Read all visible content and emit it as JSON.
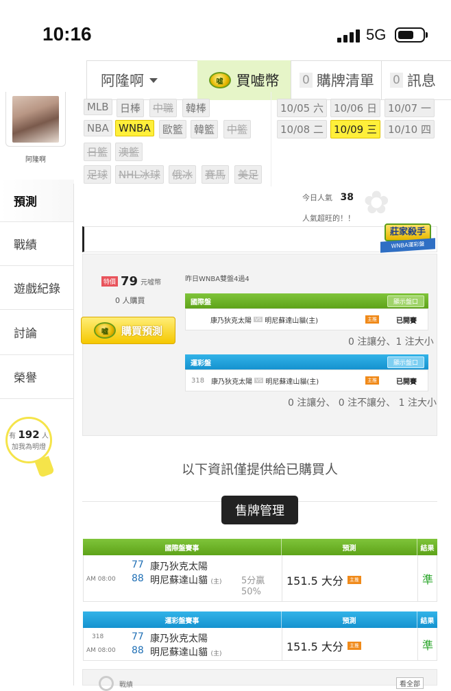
{
  "status_bar": {
    "time": "10:16",
    "network": "5G"
  },
  "top_nav": {
    "user": "阿隆啊",
    "buy_coin": "買嘘幣",
    "coin_icon_text": "嘘",
    "cart_count": "0",
    "cart_label": "購牌清單",
    "msg_count": "0",
    "msg_label": "訊息"
  },
  "profile": {
    "name": "阿隆啊"
  },
  "leagues": {
    "row1": [
      "MLB",
      "日棒",
      "中職",
      "韓棒"
    ],
    "row2": [
      "NBA",
      "WNBA",
      "歐籃",
      "韓籃",
      "中籃"
    ],
    "row3": [
      "日籃",
      "澳籃"
    ],
    "row4": [
      "足球",
      "NHL冰球",
      "俄冰",
      "賽馬",
      "美足"
    ]
  },
  "dates": {
    "row1": [
      "10/05 六",
      "10/06 日",
      "10/07 一"
    ],
    "row2": [
      "10/08 二",
      "10/09 三",
      "10/10 四"
    ]
  },
  "sidebar": {
    "items": [
      {
        "label": "預測"
      },
      {
        "label": "戰績"
      },
      {
        "label": "遊戲紀錄"
      },
      {
        "label": "討論"
      },
      {
        "label": "榮譽"
      }
    ]
  },
  "fans": {
    "prefix": "有",
    "count": "192",
    "suffix": "人",
    "action": "加我為明燈"
  },
  "popularity": {
    "label": "今日人氣",
    "value": "38",
    "note": "人氣超旺的！！"
  },
  "badge": {
    "title": "莊家殺手",
    "subtitle": "WNBA運彩盤"
  },
  "price": {
    "tag": "特價",
    "amount": "79",
    "unit": "元嘘幣",
    "buyers": "0 人購買",
    "buy_label": "購買預測"
  },
  "yesterday": "昨日WNBA雙盤4過4",
  "intl_section": {
    "title": "國際盤",
    "show_odds": "顯示盤口",
    "game": {
      "away": "康乃狄克太陽",
      "vs": "VS",
      "home": "明尼蘇達山貓(主)",
      "home_tag": "主推",
      "status": "已開賽"
    },
    "summary": "0 注讓分、1 注大小"
  },
  "lottery_section": {
    "title": "運彩盤",
    "show_odds": "顯示盤口",
    "game": {
      "id": "318",
      "away": "康乃狄克太陽",
      "vs": "VS",
      "home": "明尼蘇達山貓(主)",
      "home_tag": "主推",
      "status": "已開賽"
    },
    "summary": "0 注讓分、 0 注不讓分、 1 注大小"
  },
  "info_note": "以下資訊僅提供給已購買人",
  "manage_button": "售牌管理",
  "table_intl": {
    "headers": [
      "國際盤賽事",
      "預測",
      "結果"
    ],
    "time": "AM 08:00",
    "away_num": "77",
    "away": "康乃狄克太陽",
    "home_num": "88",
    "home": "明尼蘇達山貓",
    "home_mark": "(主)",
    "win_note": "5分贏",
    "win_pct": "50%",
    "pick": "151.5 大分",
    "pick_tag": "主推",
    "result": "準"
  },
  "table_lottery": {
    "headers": [
      "運彩盤賽事",
      "預測",
      "結果"
    ],
    "id": "318",
    "time": "AM 08:00",
    "away_num": "77",
    "away": "康乃狄克太陽",
    "home_num": "88",
    "home": "明尼蘇達山貓",
    "home_mark": "(主)",
    "pick": "151.5 大分",
    "pick_tag": "主推",
    "result": "準"
  },
  "bottom": {
    "label": "戰績",
    "see_all": "看全部"
  }
}
